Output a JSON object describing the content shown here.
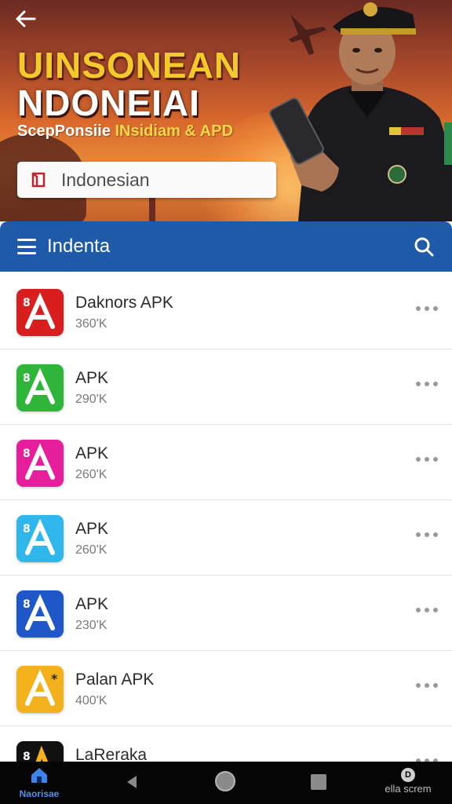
{
  "hero": {
    "title_line1": "UINSONEAN",
    "title_line2": "NDONEIAI",
    "subtitle_part1": "ScepPonsiie ",
    "subtitle_part2": "INsidiam & APD",
    "language_field_value": "Indonesian"
  },
  "appbar": {
    "title": "Indenta"
  },
  "apps": [
    {
      "name": "Daknors APK",
      "size": "360‍'K",
      "icon_color": "#d81e1e"
    },
    {
      "name": "APK",
      "size": "290‍'K",
      "icon_color": "#2fb53a"
    },
    {
      "name": "APK",
      "size": "260‍'K",
      "icon_color": "#e61e9c"
    },
    {
      "name": "APK",
      "size": "260‍'K",
      "icon_color": "#2fb7ec"
    },
    {
      "name": "APK",
      "size": "230‍'K",
      "icon_color": "#1f56c8"
    },
    {
      "name": "Palan APK",
      "size": "400‍'K",
      "icon_color": "#f3b21c"
    },
    {
      "name": "LaRerakа",
      "size": "",
      "icon_color": "#111111"
    }
  ],
  "navbar": {
    "home_label": "Naorisae",
    "screen_label": "ella screm"
  },
  "colors": {
    "appbar": "#1e5aa8",
    "hero_orange": "#d9692c",
    "title_yellow": "#f3c92c"
  }
}
